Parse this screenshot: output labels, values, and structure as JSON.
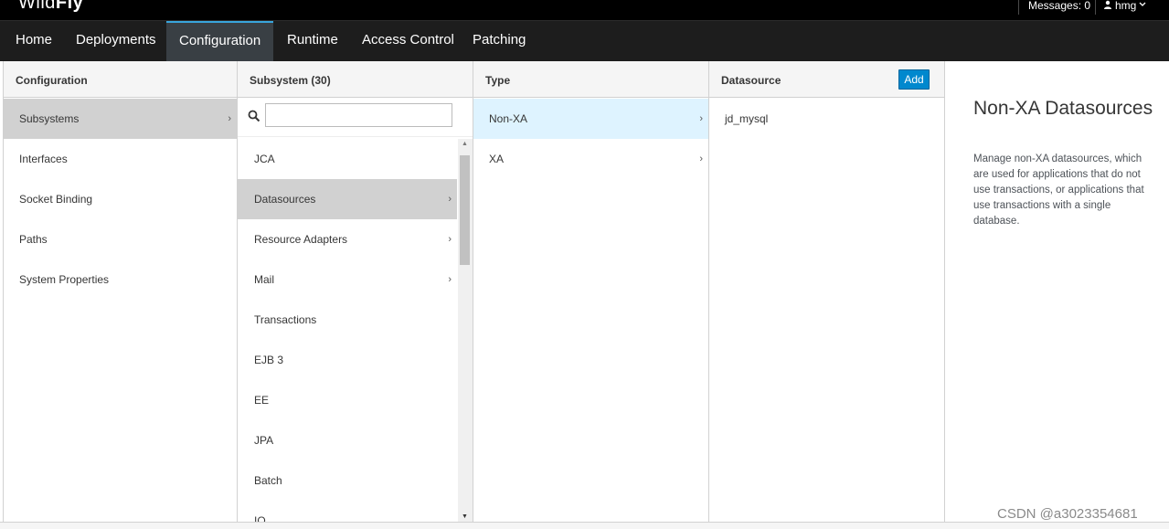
{
  "brand": {
    "light": "Wild",
    "bold": "Fly"
  },
  "utility": {
    "messages": "Messages: 0",
    "user": "hmg"
  },
  "nav": {
    "items": [
      {
        "label": "Home"
      },
      {
        "label": "Deployments"
      },
      {
        "label": "Configuration"
      },
      {
        "label": "Runtime"
      },
      {
        "label": "Access Control"
      },
      {
        "label": "Patching"
      }
    ],
    "active": "Configuration"
  },
  "columns": {
    "configuration": {
      "header": "Configuration",
      "items": [
        {
          "label": "Subsystems"
        },
        {
          "label": "Interfaces"
        },
        {
          "label": "Socket Binding"
        },
        {
          "label": "Paths"
        },
        {
          "label": "System Properties"
        }
      ]
    },
    "subsystem": {
      "header": "Subsystem (30)",
      "search_value": "",
      "items": [
        {
          "label": "JCA"
        },
        {
          "label": "Datasources"
        },
        {
          "label": "Resource Adapters"
        },
        {
          "label": "Mail"
        },
        {
          "label": "Transactions"
        },
        {
          "label": "EJB 3"
        },
        {
          "label": "EE"
        },
        {
          "label": "JPA"
        },
        {
          "label": "Batch"
        },
        {
          "label": "IO"
        }
      ]
    },
    "type": {
      "header": "Type",
      "items": [
        {
          "label": "Non-XA"
        },
        {
          "label": "XA"
        }
      ]
    },
    "datasource": {
      "header": "Datasource",
      "add_label": "Add",
      "items": [
        {
          "label": "jd_mysql"
        }
      ]
    }
  },
  "preview": {
    "title": "Non-XA Datasources",
    "description": "Manage non-XA datasources, which are used for applications that do not use transactions, or applications that use transactions with a single database."
  },
  "watermark": "CSDN @a3023354681",
  "colors": {
    "accent": "#0088ce",
    "selection_blue": "#def3ff",
    "selection_gray": "#d1d1d1",
    "nav_bg": "#1d1d1d"
  }
}
